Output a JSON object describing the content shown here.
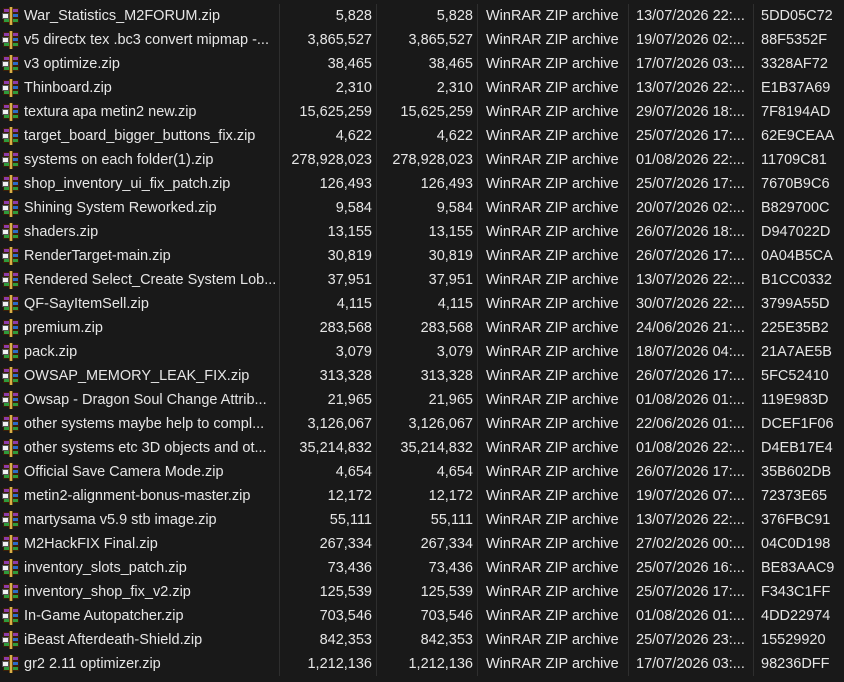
{
  "files": [
    {
      "name": "War_Statistics_M2FORUM.zip",
      "size": "5,828",
      "packed": "5,828",
      "type": "WinRAR ZIP archive",
      "modified": "13/07/2026 22:...",
      "crc": "5DD05C72"
    },
    {
      "name": "v5 directx tex .bc3 convert mipmap -...",
      "size": "3,865,527",
      "packed": "3,865,527",
      "type": "WinRAR ZIP archive",
      "modified": "19/07/2026 02:...",
      "crc": "88F5352F"
    },
    {
      "name": "v3 optimize.zip",
      "size": "38,465",
      "packed": "38,465",
      "type": "WinRAR ZIP archive",
      "modified": "17/07/2026 03:...",
      "crc": "3328AF72"
    },
    {
      "name": "Thinboard.zip",
      "size": "2,310",
      "packed": "2,310",
      "type": "WinRAR ZIP archive",
      "modified": "13/07/2026 22:...",
      "crc": "E1B37A69"
    },
    {
      "name": "textura apa metin2 new.zip",
      "size": "15,625,259",
      "packed": "15,625,259",
      "type": "WinRAR ZIP archive",
      "modified": "29/07/2026 18:...",
      "crc": "7F8194AD"
    },
    {
      "name": "target_board_bigger_buttons_fix.zip",
      "size": "4,622",
      "packed": "4,622",
      "type": "WinRAR ZIP archive",
      "modified": "25/07/2026 17:...",
      "crc": "62E9CEAA"
    },
    {
      "name": "systems on each folder(1).zip",
      "size": "278,928,023",
      "packed": "278,928,023",
      "type": "WinRAR ZIP archive",
      "modified": "01/08/2026 22:...",
      "crc": "11709C81"
    },
    {
      "name": "shop_inventory_ui_fix_patch.zip",
      "size": "126,493",
      "packed": "126,493",
      "type": "WinRAR ZIP archive",
      "modified": "25/07/2026 17:...",
      "crc": "7670B9C6"
    },
    {
      "name": "Shining System Reworked.zip",
      "size": "9,584",
      "packed": "9,584",
      "type": "WinRAR ZIP archive",
      "modified": "20/07/2026 02:...",
      "crc": "B829700C"
    },
    {
      "name": "shaders.zip",
      "size": "13,155",
      "packed": "13,155",
      "type": "WinRAR ZIP archive",
      "modified": "26/07/2026 18:...",
      "crc": "D947022D"
    },
    {
      "name": "RenderTarget-main.zip",
      "size": "30,819",
      "packed": "30,819",
      "type": "WinRAR ZIP archive",
      "modified": "26/07/2026 17:...",
      "crc": "0A04B5CA"
    },
    {
      "name": "Rendered Select_Create System Lob...",
      "size": "37,951",
      "packed": "37,951",
      "type": "WinRAR ZIP archive",
      "modified": "13/07/2026 22:...",
      "crc": "B1CC0332"
    },
    {
      "name": "QF-SayItemSell.zip",
      "size": "4,115",
      "packed": "4,115",
      "type": "WinRAR ZIP archive",
      "modified": "30/07/2026 22:...",
      "crc": "3799A55D"
    },
    {
      "name": "premium.zip",
      "size": "283,568",
      "packed": "283,568",
      "type": "WinRAR ZIP archive",
      "modified": "24/06/2026 21:...",
      "crc": "225E35B2"
    },
    {
      "name": "pack.zip",
      "size": "3,079",
      "packed": "3,079",
      "type": "WinRAR ZIP archive",
      "modified": "18/07/2026 04:...",
      "crc": "21A7AE5B"
    },
    {
      "name": "OWSAP_MEMORY_LEAK_FIX.zip",
      "size": "313,328",
      "packed": "313,328",
      "type": "WinRAR ZIP archive",
      "modified": "26/07/2026 17:...",
      "crc": "5FC52410"
    },
    {
      "name": "Owsap - Dragon Soul Change Attrib...",
      "size": "21,965",
      "packed": "21,965",
      "type": "WinRAR ZIP archive",
      "modified": "01/08/2026 01:...",
      "crc": "119E983D"
    },
    {
      "name": "other systems maybe help to compl...",
      "size": "3,126,067",
      "packed": "3,126,067",
      "type": "WinRAR ZIP archive",
      "modified": "22/06/2026 01:...",
      "crc": "DCEF1F06"
    },
    {
      "name": "other systems etc 3D objects and ot...",
      "size": "35,214,832",
      "packed": "35,214,832",
      "type": "WinRAR ZIP archive",
      "modified": "01/08/2026 22:...",
      "crc": "D4EB17E4"
    },
    {
      "name": "Official Save Camera Mode.zip",
      "size": "4,654",
      "packed": "4,654",
      "type": "WinRAR ZIP archive",
      "modified": "26/07/2026 17:...",
      "crc": "35B602DB"
    },
    {
      "name": "metin2-alignment-bonus-master.zip",
      "size": "12,172",
      "packed": "12,172",
      "type": "WinRAR ZIP archive",
      "modified": "19/07/2026 07:...",
      "crc": "72373E65"
    },
    {
      "name": "martysama v5.9 stb image.zip",
      "size": "55,111",
      "packed": "55,111",
      "type": "WinRAR ZIP archive",
      "modified": "13/07/2026 22:...",
      "crc": "376FBC91"
    },
    {
      "name": "M2HackFIX Final.zip",
      "size": "267,334",
      "packed": "267,334",
      "type": "WinRAR ZIP archive",
      "modified": "27/02/2026 00:...",
      "crc": "04C0D198"
    },
    {
      "name": "inventory_slots_patch.zip",
      "size": "73,436",
      "packed": "73,436",
      "type": "WinRAR ZIP archive",
      "modified": "25/07/2026 16:...",
      "crc": "BE83AAC9"
    },
    {
      "name": "inventory_shop_fix_v2.zip",
      "size": "125,539",
      "packed": "125,539",
      "type": "WinRAR ZIP archive",
      "modified": "25/07/2026 17:...",
      "crc": "F343C1FF"
    },
    {
      "name": "In-Game Autopatcher.zip",
      "size": "703,546",
      "packed": "703,546",
      "type": "WinRAR ZIP archive",
      "modified": "01/08/2026 01:...",
      "crc": "4DD22974"
    },
    {
      "name": "iBeast Afterdeath-Shield.zip",
      "size": "842,353",
      "packed": "842,353",
      "type": "WinRAR ZIP archive",
      "modified": "25/07/2026 23:...",
      "crc": "15529920"
    },
    {
      "name": "gr2 2.11 optimizer.zip",
      "size": "1,212,136",
      "packed": "1,212,136",
      "type": "WinRAR ZIP archive",
      "modified": "17/07/2026 03:...",
      "crc": "98236DFF"
    }
  ],
  "icon": "winrar-archive-icon"
}
